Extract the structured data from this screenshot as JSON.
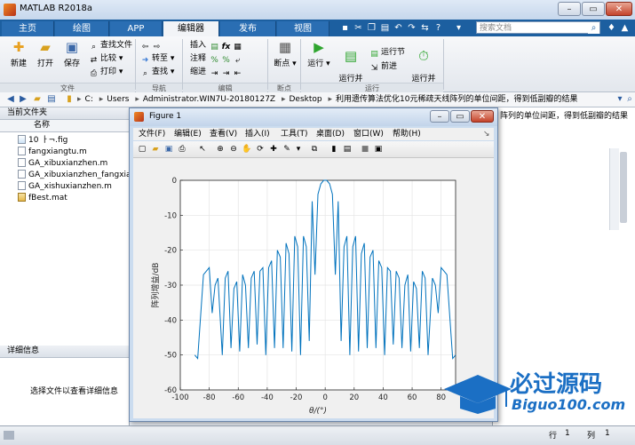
{
  "window": {
    "title": "MATLAB R2018a"
  },
  "tabs": [
    {
      "label": "主页"
    },
    {
      "label": "绘图"
    },
    {
      "label": "APP"
    },
    {
      "label": "编辑器"
    },
    {
      "label": "发布"
    },
    {
      "label": "视图"
    }
  ],
  "search": {
    "placeholder": "搜索文档"
  },
  "ribbon": {
    "file_section": {
      "title": "文件",
      "new": "新建",
      "open": "打开",
      "save": "保存",
      "find_files": "查找文件",
      "compare": "比较",
      "print": "打印"
    },
    "nav_section": {
      "title": "导航",
      "goto": "转至",
      "find": "查找"
    },
    "edit_section": {
      "title": "编辑",
      "insert": "插入",
      "comment": "注释",
      "indent": "缩进",
      "fx": "fx"
    },
    "breakpoint_section": {
      "title": "断点",
      "breakpoint": "断点"
    },
    "run_section": {
      "title": "运行",
      "run": "运行",
      "run_advance": "运行并\n前进",
      "run_section": "运行节",
      "advance": "前进",
      "run_time": "运行并\n计时"
    }
  },
  "address": {
    "crumbs": [
      "C:",
      "Users",
      "Administrator.WIN7U-20180127Z",
      "Desktop",
      "利用遗传算法优化10元稀疏天线阵列的单位间距，得到低副瓣的结果"
    ]
  },
  "current_folder": {
    "title": "当前文件夹",
    "column": "名称",
    "files": [
      {
        "name": "10 ㅏ¬.fig",
        "type": "fig"
      },
      {
        "name": "fangxiangtu.m",
        "type": "m"
      },
      {
        "name": "GA_xibuxianzhen.m",
        "type": "m"
      },
      {
        "name": "GA_xibuxianzhen_fangxiangtu.m",
        "type": "m"
      },
      {
        "name": "GA_xishuxianzhen.m",
        "type": "m"
      },
      {
        "name": "fBest.mat",
        "type": "mat"
      }
    ]
  },
  "details": {
    "title": "详细信息",
    "empty": "选择文件以查看详细信息"
  },
  "right_panel": {
    "behind_text": "阵列的单位间距，得到低副瓣的结果"
  },
  "status": {
    "row_label": "行",
    "row_value": "1",
    "col_label": "列",
    "col_value": "1"
  },
  "figure": {
    "title": "Figure 1",
    "menus": [
      "文件(F)",
      "编辑(E)",
      "查看(V)",
      "插入(I)",
      "工具(T)",
      "桌面(D)",
      "窗口(W)",
      "帮助(H)"
    ]
  },
  "watermark": {
    "title": "必过源码",
    "url": "Biguo100.com"
  },
  "colors": {
    "line": "#0072bd",
    "tabbar": "#1c5fa0",
    "watermark": "#1b6fc4"
  },
  "chart_data": {
    "type": "line",
    "xlabel": "θ/(°)",
    "ylabel": "阵列增益/dB",
    "xlim": [
      -100,
      90
    ],
    "ylim": [
      -60,
      0
    ],
    "xticks": [
      -100,
      -80,
      -60,
      -40,
      -20,
      0,
      20,
      40,
      60,
      80
    ],
    "yticks": [
      0,
      -10,
      -20,
      -30,
      -40,
      -50,
      -60
    ],
    "grid": true,
    "series": [
      {
        "x": [
          -90,
          -88,
          -84,
          -80,
          -78,
          -76,
          -74,
          -71,
          -69,
          -67,
          -65,
          -63,
          -61,
          -59,
          -57,
          -55,
          -53,
          -51,
          -49,
          -47,
          -45,
          -43,
          -41,
          -39,
          -37,
          -35,
          -33,
          -31,
          -29,
          -27,
          -25,
          -23,
          -21,
          -19,
          -17,
          -15,
          -13,
          -11,
          -9,
          -7,
          -5,
          -3,
          -1,
          0,
          1,
          3,
          5,
          7,
          9,
          11,
          13,
          15,
          17,
          19,
          21,
          23,
          25,
          27,
          29,
          31,
          33,
          35,
          37,
          39,
          41,
          43,
          45,
          47,
          49,
          51,
          53,
          55,
          57,
          59,
          61,
          63,
          65,
          67,
          69,
          71,
          74,
          76,
          78,
          80,
          84,
          88,
          90
        ],
        "y": [
          -50,
          -51,
          -27,
          -25,
          -38,
          -30,
          -28,
          -50,
          -28,
          -26,
          -48,
          -31,
          -29,
          -49,
          -27,
          -30,
          -48,
          -28,
          -26,
          -47,
          -26,
          -25,
          -50,
          -25,
          -23,
          -48,
          -20,
          -22,
          -48,
          -18,
          -21,
          -49,
          -16,
          -19,
          -50,
          -16,
          -19,
          -46,
          -6,
          -27,
          -4,
          -1,
          0,
          0,
          0,
          -1,
          -4,
          -27,
          -6,
          -46,
          -19,
          -16,
          -50,
          -19,
          -16,
          -49,
          -21,
          -18,
          -48,
          -22,
          -20,
          -48,
          -23,
          -25,
          -50,
          -25,
          -26,
          -47,
          -26,
          -28,
          -48,
          -30,
          -27,
          -49,
          -29,
          -31,
          -48,
          -26,
          -28,
          -50,
          -28,
          -30,
          -38,
          -25,
          -27,
          -51,
          -50
        ]
      }
    ]
  }
}
